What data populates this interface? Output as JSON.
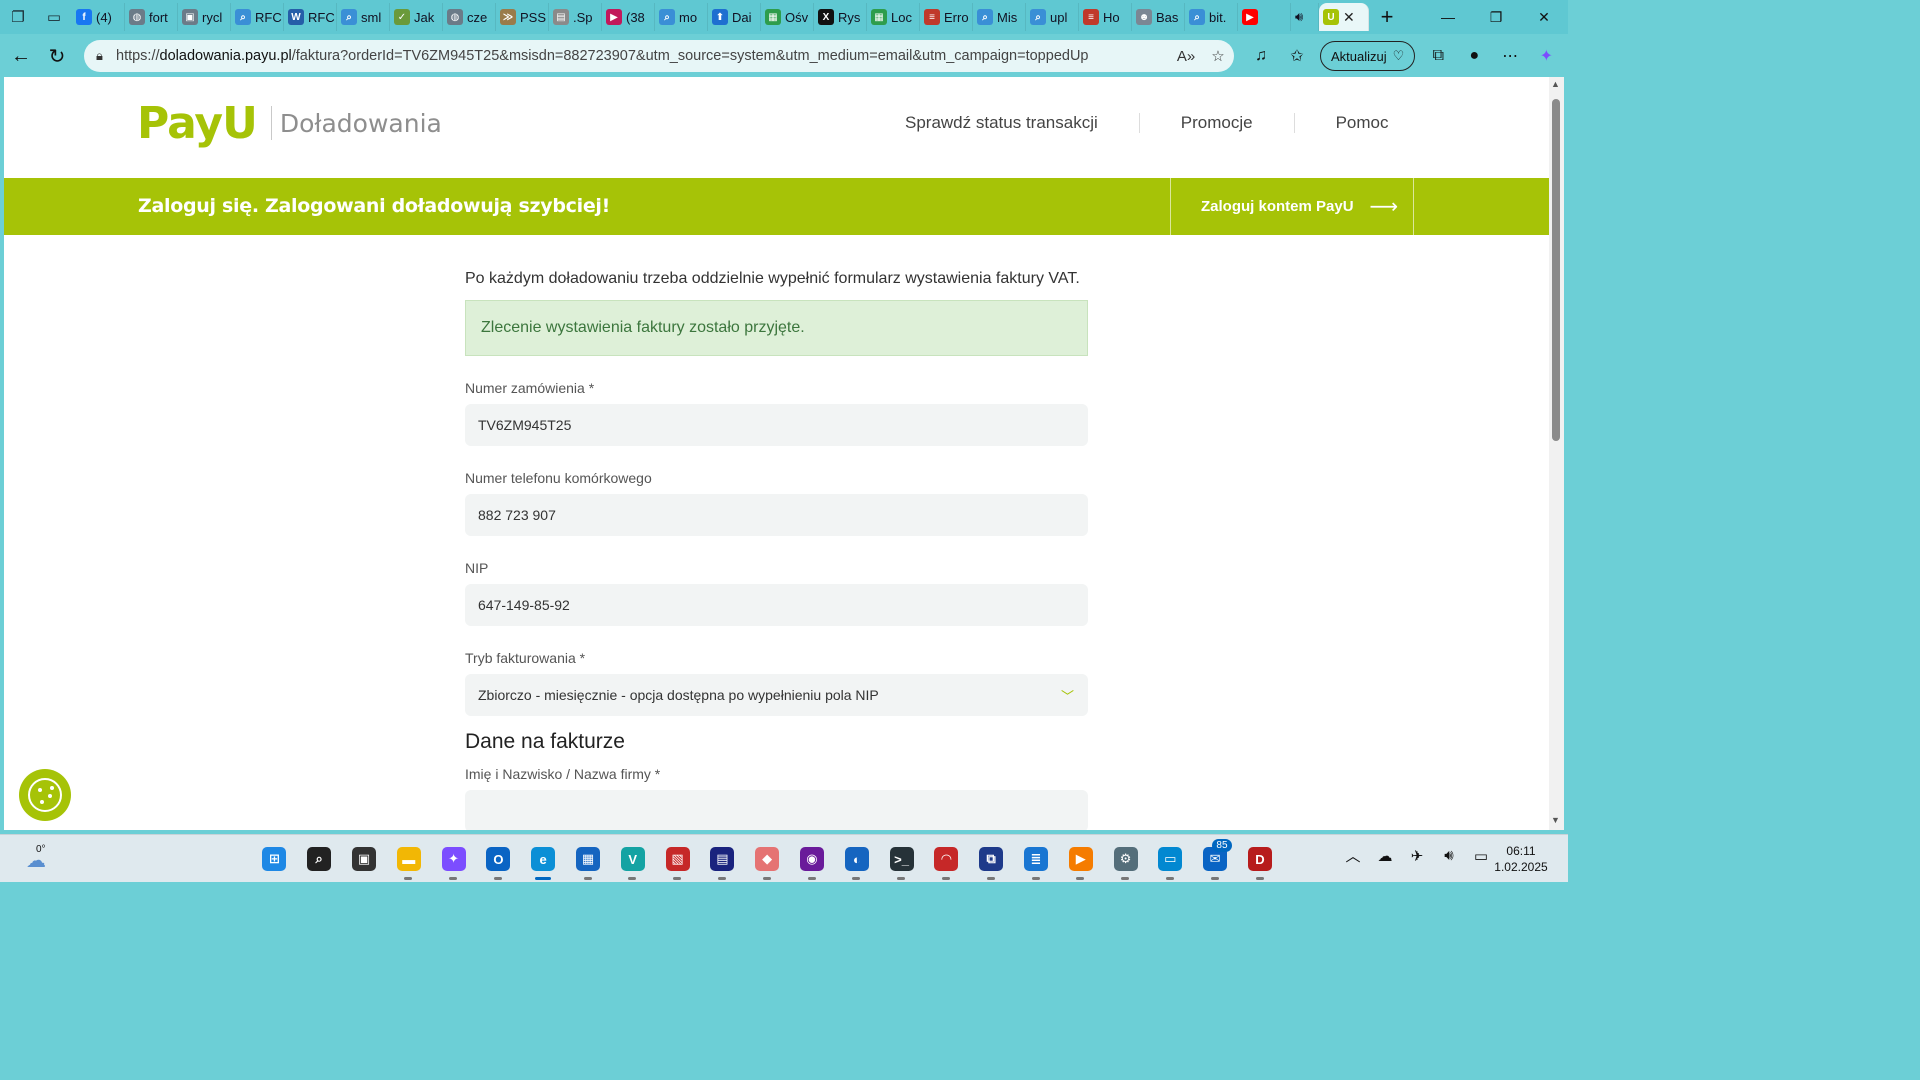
{
  "browser": {
    "tabs": [
      {
        "icon": "facebook-icon",
        "label": "(4)",
        "color": "#1877f2",
        "glyph": "f"
      },
      {
        "icon": "globe-icon",
        "label": "fort",
        "color": "#6b7b88",
        "glyph": "◍"
      },
      {
        "icon": "page-icon",
        "label": "rycl",
        "color": "#6b7b88",
        "glyph": "▣"
      },
      {
        "icon": "search-icon",
        "label": "RFC",
        "color": "#3a8fd6",
        "glyph": "⌕"
      },
      {
        "icon": "w3c-icon",
        "label": "RFC",
        "color": "#255ea8",
        "glyph": "W"
      },
      {
        "icon": "search-icon",
        "label": "sml",
        "color": "#3a8fd6",
        "glyph": "⌕"
      },
      {
        "icon": "leaf-icon",
        "label": "Jak",
        "color": "#6a9a3a",
        "glyph": "✓"
      },
      {
        "icon": "globe-icon",
        "label": "cze",
        "color": "#6b7b88",
        "glyph": "◍"
      },
      {
        "icon": "chevron-icon",
        "label": "PSS",
        "color": "#9a7b4a",
        "glyph": "≫"
      },
      {
        "icon": "page-icon",
        "label": ".Sp",
        "color": "#8a8a8a",
        "glyph": "▤"
      },
      {
        "icon": "video-icon",
        "label": "(38",
        "color": "#c2185b",
        "glyph": "▶"
      },
      {
        "icon": "search-icon",
        "label": "mo",
        "color": "#3a8fd6",
        "glyph": "⌕"
      },
      {
        "icon": "pin-icon",
        "label": "Dai",
        "color": "#1e6fd0",
        "glyph": "⬆"
      },
      {
        "icon": "windows-icon",
        "label": "Ośv",
        "color": "#2e9d4c",
        "glyph": "▦"
      },
      {
        "icon": "x-icon",
        "label": "Rys",
        "color": "#111111",
        "glyph": "X"
      },
      {
        "icon": "windows-icon",
        "label": "Loc",
        "color": "#2e9d4c",
        "glyph": "▦"
      },
      {
        "icon": "error-icon",
        "label": "Erro",
        "color": "#c0392b",
        "glyph": "≡"
      },
      {
        "icon": "search-icon",
        "label": "Mis",
        "color": "#3a8fd6",
        "glyph": "⌕"
      },
      {
        "icon": "search-icon",
        "label": "upl",
        "color": "#3a8fd6",
        "glyph": "⌕"
      },
      {
        "icon": "error-icon",
        "label": "Ho",
        "color": "#c0392b",
        "glyph": "≡"
      },
      {
        "icon": "bot-icon",
        "label": "Bas",
        "color": "#7b8794",
        "glyph": "☻"
      },
      {
        "icon": "search-icon",
        "label": "bit.",
        "color": "#3a8fd6",
        "glyph": "⌕"
      },
      {
        "icon": "youtube-icon",
        "label": "",
        "color": "#ff0000",
        "glyph": "▶"
      }
    ],
    "active_tab": {
      "icon": "payu-icon",
      "color": "#a6c307",
      "glyph": "U"
    },
    "url_prefix": "https://",
    "url_host": "doladowania.payu.pl",
    "url_path": "/faktura?orderId=TV6ZM945T25&msisdn=882723907&utm_source=system&utm_medium=email&utm_campaign=toppedUp",
    "update_label": "Aktualizuj"
  },
  "site": {
    "logo_text": "PayU",
    "logo_sub": "Doładowania",
    "nav": [
      "Sprawdź status transakcji",
      "Promocje",
      "Pomoc"
    ],
    "banner_text": "Zaloguj się. Zalogowani doładowują szybciej!",
    "banner_login": "Zaloguj kontem PayU",
    "accent": "#a6c307"
  },
  "form": {
    "intro": "Po każdym doładowaniu trzeba oddzielnie wypełnić formularz wystawienia faktury VAT.",
    "success": "Zlecenie wystawienia faktury zostało przyjęte.",
    "order_label": "Numer zamówienia *",
    "order_value": "TV6ZM945T25",
    "phone_label": "Numer telefonu komórkowego",
    "phone_value": "882 723 907",
    "nip_label": "NIP",
    "nip_value": "647-149-85-92",
    "mode_label": "Tryb fakturowania *",
    "mode_value": "Zbiorczo - miesięcznie - opcja dostępna po wypełnieniu pola NIP",
    "section_title": "Dane na fakturze",
    "name_label": "Imię i Nazwisko / Nazwa firmy *",
    "name_value": ""
  },
  "taskbar": {
    "weather_temp": "0°",
    "apps": [
      {
        "name": "start-icon",
        "color": "#1e88e5",
        "glyph": "⊞"
      },
      {
        "name": "search-icon",
        "color": "#222222",
        "glyph": "⌕"
      },
      {
        "name": "taskview-icon",
        "color": "#333333",
        "glyph": "▣"
      },
      {
        "name": "file-explorer-icon",
        "color": "#f2b705",
        "glyph": "▬"
      },
      {
        "name": "copilot-icon",
        "color": "#7c4dff",
        "glyph": "✦"
      },
      {
        "name": "outlook-icon",
        "color": "#0a64c4",
        "glyph": "O"
      },
      {
        "name": "edge-icon",
        "color": "#0b8fd6",
        "glyph": "e"
      },
      {
        "name": "store-icon",
        "color": "#1565c0",
        "glyph": "▦"
      },
      {
        "name": "vs-icon",
        "color": "#14a3a3",
        "glyph": "V"
      },
      {
        "name": "x64-tool-icon",
        "color": "#c62828",
        "glyph": "▧"
      },
      {
        "name": "save-tool-icon",
        "color": "#1a237e",
        "glyph": "▤"
      },
      {
        "name": "diamond-app-icon",
        "color": "#e57373",
        "glyph": "◆"
      },
      {
        "name": "github-icon",
        "color": "#6a1b9a",
        "glyph": "◉"
      },
      {
        "name": "shield-app-icon",
        "color": "#1565c0",
        "glyph": "◐"
      },
      {
        "name": "terminal-icon",
        "color": "#263238",
        "glyph": ">_"
      },
      {
        "name": "headphones-app-icon",
        "color": "#c62828",
        "glyph": "◠"
      },
      {
        "name": "network-app-icon",
        "color": "#1e3a8a",
        "glyph": "⧉"
      },
      {
        "name": "notepad-icon",
        "color": "#1976d2",
        "glyph": "≣"
      },
      {
        "name": "media-player-icon",
        "color": "#f57c00",
        "glyph": "▶"
      },
      {
        "name": "settings-icon",
        "color": "#546e7a",
        "glyph": "⚙"
      },
      {
        "name": "remote-desktop-icon",
        "color": "#0288d1",
        "glyph": "▭"
      },
      {
        "name": "outlook-new-icon",
        "color": "#0a64c4",
        "glyph": "✉",
        "badge": "85"
      },
      {
        "name": "d-app-icon",
        "color": "#b71c1c",
        "glyph": "D"
      }
    ],
    "time": "06:11",
    "date": "1.02.2025"
  }
}
